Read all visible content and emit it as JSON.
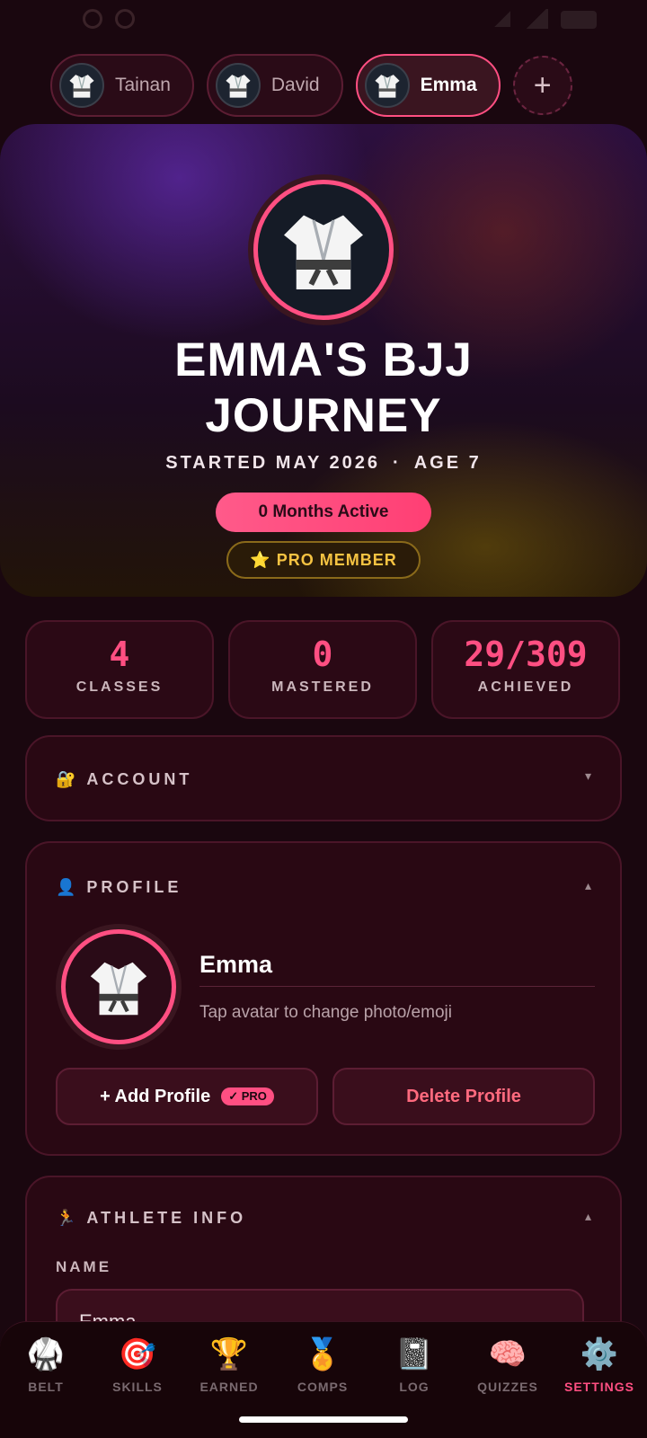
{
  "profile_tabs": [
    {
      "name": "Tainan",
      "active": false
    },
    {
      "name": "David",
      "active": false
    },
    {
      "name": "Emma",
      "active": true
    }
  ],
  "add_profile_icon": "+",
  "hero": {
    "avatar_icon": "gi-icon",
    "title": "EMMA'S BJJ JOURNEY",
    "started": "STARTED MAY 2026",
    "separator": "·",
    "age": "AGE 7",
    "months_active": "0 Months Active",
    "pro_member": "⭐ PRO MEMBER"
  },
  "stats": [
    {
      "value": "4",
      "label": "CLASSES"
    },
    {
      "value": "0",
      "label": "MASTERED"
    },
    {
      "value": "29/309",
      "label": "ACHIEVED"
    }
  ],
  "account": {
    "icon": "🔐",
    "title": "ACCOUNT",
    "chevron": "▾"
  },
  "profile_section": {
    "icon": "👤",
    "title": "PROFILE",
    "chevron": "▴",
    "name": "Emma",
    "hint": "Tap avatar to change photo/emoji",
    "add_profile_label": "+ Add Profile",
    "pro_badge": "✓ PRO",
    "delete_profile_label": "Delete Profile"
  },
  "athlete_info": {
    "icon": "🏃",
    "title": "ATHLETE INFO",
    "chevron": "▴",
    "name_label": "NAME",
    "name_value": "Emma"
  },
  "bottom_nav": [
    {
      "icon": "🥋",
      "label": "BELT",
      "active": false
    },
    {
      "icon": "🎯",
      "label": "SKILLS",
      "active": false
    },
    {
      "icon": "🏆",
      "label": "EARNED",
      "active": false
    },
    {
      "icon": "🏅",
      "label": "COMPS",
      "active": false
    },
    {
      "icon": "📓",
      "label": "LOG",
      "active": false
    },
    {
      "icon": "🧠",
      "label": "QUIZZES",
      "active": false
    },
    {
      "icon": "⚙️",
      "label": "SETTINGS",
      "active": true
    }
  ],
  "colors": {
    "accent": "#ff4f82",
    "background": "#1a070f",
    "gold": "#f6c342",
    "danger": "#ff6a7e"
  }
}
